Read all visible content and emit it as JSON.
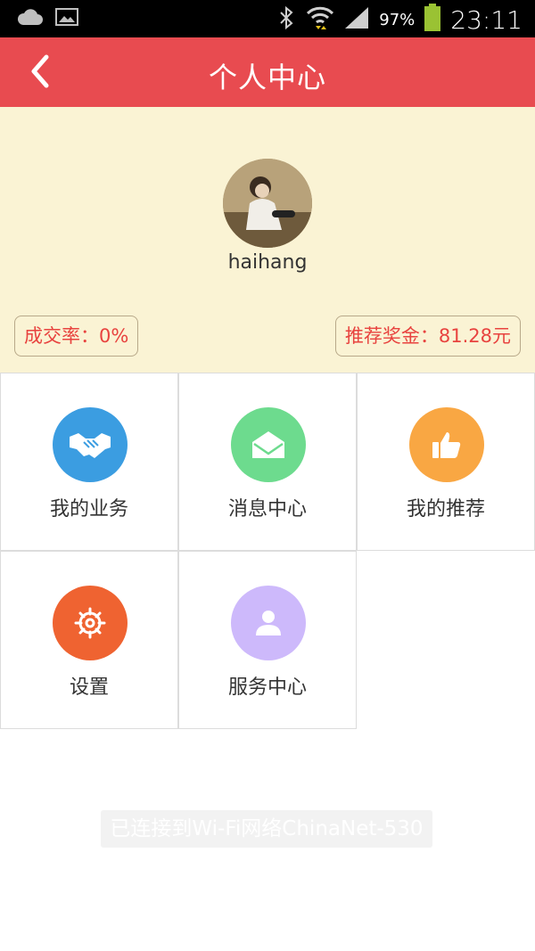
{
  "status_bar": {
    "battery_percent": "97%",
    "time": "23:11",
    "icons": [
      "cloud-icon",
      "image-icon",
      "bluetooth-icon",
      "wifi-icon",
      "signal-icon",
      "battery-icon"
    ]
  },
  "header": {
    "title": "个人中心",
    "back_icon": "back-icon"
  },
  "profile": {
    "username": "haihang",
    "deal_rate": "成交率：0%",
    "referral_bonus": "推荐奖金：81.28元"
  },
  "menu": {
    "items": [
      {
        "label": "我的业务",
        "icon": "handshake-icon",
        "color": "#3b9de1"
      },
      {
        "label": "消息中心",
        "icon": "mail-icon",
        "color": "#6ddb8e"
      },
      {
        "label": "我的推荐",
        "icon": "thumbs-up-icon",
        "color": "#f9a743"
      },
      {
        "label": "设置",
        "icon": "gear-icon",
        "color": "#ef6331"
      },
      {
        "label": "服务中心",
        "icon": "person-icon",
        "color": "#cdb9fb"
      }
    ]
  },
  "toast": {
    "text": "已连接到Wi-Fi网络ChinaNet-530"
  },
  "colors": {
    "accent": "#e84b50",
    "profile_bg": "#faf3d4",
    "highlight_text": "#e8433f"
  }
}
